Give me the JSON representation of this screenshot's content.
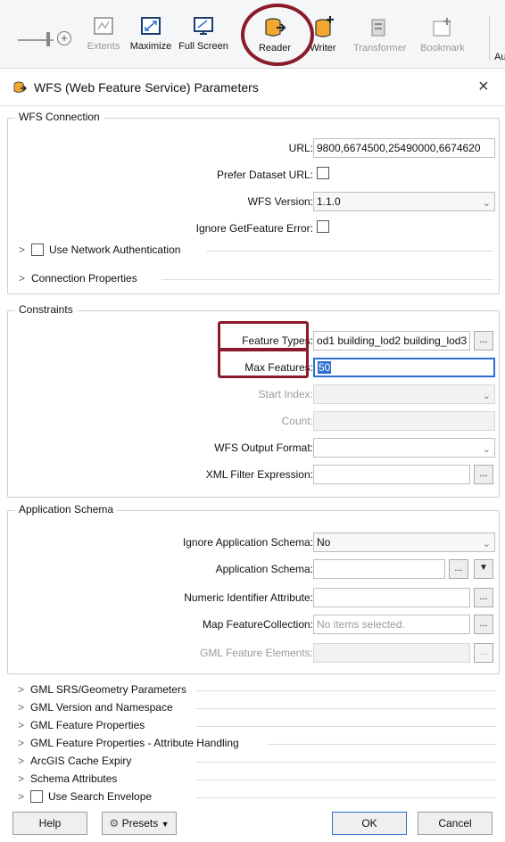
{
  "toolbar": {
    "buttons": [
      {
        "label": "Extents",
        "icon": "extents-icon",
        "disabled": true
      },
      {
        "label": "Maximize",
        "icon": "maximize-icon",
        "disabled": false
      },
      {
        "label": "Full Screen",
        "icon": "full-screen-icon",
        "disabled": false
      },
      {
        "label": "Reader",
        "icon": "reader-icon",
        "disabled": false
      },
      {
        "label": "Writer",
        "icon": "writer-icon",
        "disabled": false
      },
      {
        "label": "Transformer",
        "icon": "transformer-icon",
        "disabled": true
      },
      {
        "label": "Bookmark",
        "icon": "bookmark-icon",
        "disabled": true
      }
    ],
    "cut_label": "Au",
    "zoom_icon": "zoom-in-icon",
    "highlight_color": "#8b1a2b"
  },
  "dialog": {
    "title": "WFS (Web Feature Service) Parameters",
    "close": "×",
    "wfs_connection": {
      "legend": "WFS Connection",
      "url_label": "URL:",
      "url_value": "9800,6674500,25490000,6674620",
      "prefer_label": "Prefer Dataset URL:",
      "version_label": "WFS Version:",
      "version_value": "1.1.0",
      "ignore_label": "Ignore GetFeature Error:",
      "network_auth_label": "Use Network Authentication",
      "connection_props_label": "Connection Properties"
    },
    "constraints": {
      "legend": "Constraints",
      "feature_types_label": "Feature Types:",
      "feature_types_value": "od1 building_lod2 building_lod3",
      "max_features_label": "Max Features:",
      "max_features_value": "50",
      "start_index_label": "Start Index:",
      "count_label": "Count:",
      "output_format_label": "WFS Output Format:",
      "xml_filter_label": "XML Filter Expression:"
    },
    "app_schema": {
      "legend": "Application Schema",
      "ignore_label": "Ignore Application Schema:",
      "ignore_value": "No",
      "schema_label": "Application Schema:",
      "numeric_id_label": "Numeric Identifier Attribute:",
      "map_collection_label": "Map FeatureCollection:",
      "map_collection_placeholder": "No items selected.",
      "gml_elements_label": "GML Feature Elements:"
    },
    "sections": [
      "GML SRS/Geometry Parameters",
      "GML Version and Namespace",
      "GML Feature Properties",
      "GML Feature Properties - Attribute Handling",
      "ArcGIS Cache Expiry",
      "Schema Attributes"
    ],
    "search_envelope_label": "Use Search Envelope",
    "buttons": {
      "help": "Help",
      "presets": "Presets",
      "ok": "OK",
      "cancel": "Cancel"
    },
    "ellipsis": "...",
    "chevron_right": ">",
    "chevron_down": "⌄",
    "accent_color": "#2d6fd2"
  }
}
